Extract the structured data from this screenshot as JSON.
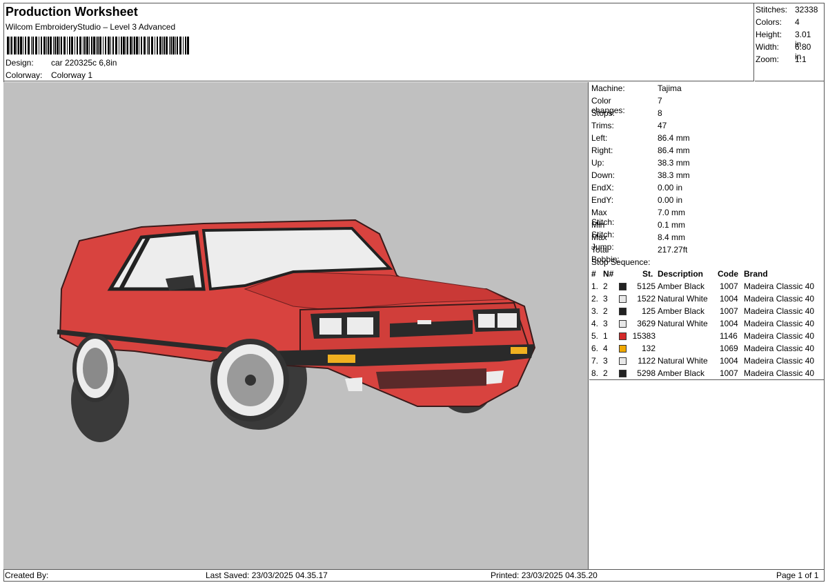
{
  "header": {
    "title": "Production Worksheet",
    "software": "Wilcom EmbroideryStudio – Level 3 Advanced",
    "design_label": "Design:",
    "design_value": "car 220325c 6,8in",
    "colorway_label": "Colorway:",
    "colorway_value": "Colorway 1"
  },
  "summary": {
    "stitches_label": "Stitches:",
    "stitches": "32338",
    "colors_label": "Colors:",
    "colors": "4",
    "height_label": "Height:",
    "height": "3.01 in",
    "width_label": "Width:",
    "width": "6.80 in",
    "zoom_label": "Zoom:",
    "zoom": "1:1"
  },
  "machine_info": [
    {
      "label": "Machine:",
      "value": "Tajima"
    },
    {
      "label": "Color changes:",
      "value": "7"
    },
    {
      "label": "Stops:",
      "value": "8"
    },
    {
      "label": "Trims:",
      "value": "47"
    },
    {
      "label": "Left:",
      "value": "86.4 mm"
    },
    {
      "label": "Right:",
      "value": "86.4 mm"
    },
    {
      "label": "Up:",
      "value": "38.3 mm"
    },
    {
      "label": "Down:",
      "value": "38.3 mm"
    },
    {
      "label": "EndX:",
      "value": "0.00 in"
    },
    {
      "label": "EndY:",
      "value": "0.00 in"
    },
    {
      "label": "Max Stitch:",
      "value": "7.0 mm"
    },
    {
      "label": "Min Stitch:",
      "value": "0.1 mm"
    },
    {
      "label": "Max Jump:",
      "value": "8.4 mm"
    },
    {
      "label": "Total Bobbin:",
      "value": "217.27ft"
    }
  ],
  "stop_sequence": {
    "title": "Stop Sequence:",
    "columns": {
      "num": "#",
      "n": "N#",
      "st": "St.",
      "description": "Description",
      "code": "Code",
      "brand": "Brand"
    },
    "rows": [
      {
        "num": "1.",
        "n": "2",
        "color": "#222222",
        "st": "5125",
        "description": "Amber Black",
        "code": "1007",
        "brand": "Madeira Classic 40"
      },
      {
        "num": "2.",
        "n": "3",
        "color": "#e8e8e8",
        "st": "1522",
        "description": "Natural White",
        "code": "1004",
        "brand": "Madeira Classic 40"
      },
      {
        "num": "3.",
        "n": "2",
        "color": "#222222",
        "st": "125",
        "description": "Amber Black",
        "code": "1007",
        "brand": "Madeira Classic 40"
      },
      {
        "num": "4.",
        "n": "3",
        "color": "#e8e8e8",
        "st": "3629",
        "description": "Natural White",
        "code": "1004",
        "brand": "Madeira Classic 40"
      },
      {
        "num": "5.",
        "n": "1",
        "color": "#d42a2a",
        "st": "15383",
        "description": "",
        "code": "1146",
        "brand": "Madeira Classic 40"
      },
      {
        "num": "6.",
        "n": "4",
        "color": "#f0a800",
        "st": "132",
        "description": "",
        "code": "1069",
        "brand": "Madeira Classic 40"
      },
      {
        "num": "7.",
        "n": "3",
        "color": "#e8e8e8",
        "st": "1122",
        "description": "Natural White",
        "code": "1004",
        "brand": "Madeira Classic 40"
      },
      {
        "num": "8.",
        "n": "2",
        "color": "#222222",
        "st": "5298",
        "description": "Amber Black",
        "code": "1007",
        "brand": "Madeira Classic 40"
      }
    ]
  },
  "footer": {
    "created_by": "Created By:",
    "last_saved": "Last Saved: 23/03/2025 04.35.17",
    "printed": "Printed: 23/03/2025 04.35.20",
    "page": "Page 1 of 1"
  },
  "colors": {
    "preview_bg": "#c0c0c0",
    "car_red": "#d8433f",
    "car_dark_red": "#a82a28",
    "black": "#2a2a2a",
    "white_thread": "#ececec",
    "amber": "#f0b020"
  }
}
